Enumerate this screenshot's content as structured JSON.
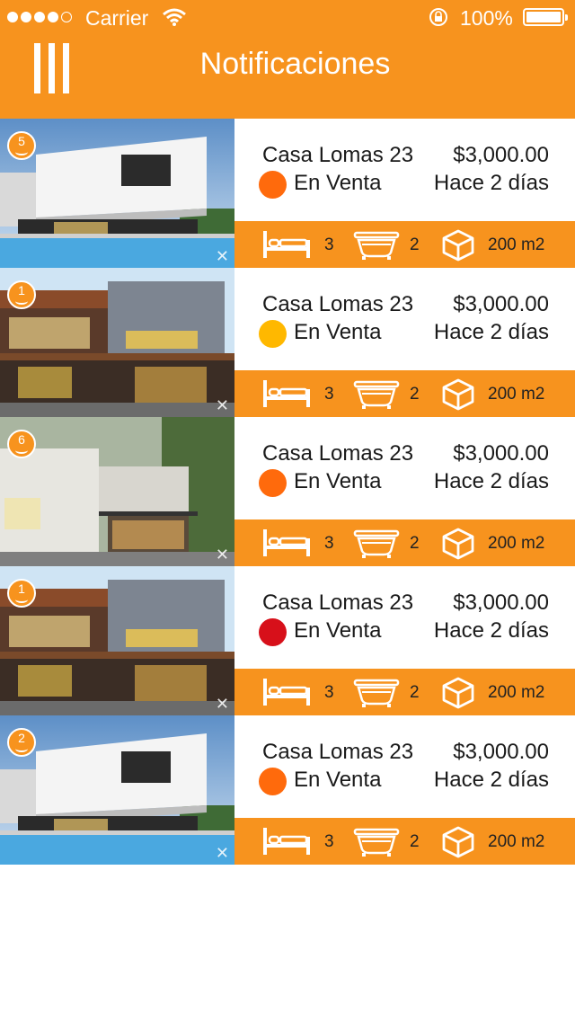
{
  "status_bar": {
    "carrier": "Carrier",
    "battery_pct": "100%"
  },
  "header": {
    "title": "Notificaciones",
    "menu_icon": "menu-icon"
  },
  "colors": {
    "brand": "#F7931E",
    "status_orange": "#FF6A0C",
    "status_yellow": "#FFB800",
    "status_red": "#D7101A"
  },
  "listings": [
    {
      "badge": "5",
      "image": "house-modern-pool",
      "name": "Casa Lomas 23",
      "price": "$3,000.00",
      "status": "En Venta",
      "status_color": "#FF6A0C",
      "time": "Hace 2 días",
      "beds": "3",
      "baths": "2",
      "area": "200 m2"
    },
    {
      "badge": "1",
      "image": "house-wood-brick",
      "name": "Casa Lomas 23",
      "price": "$3,000.00",
      "status": "En Venta",
      "status_color": "#FFB800",
      "time": "Hace 2 días",
      "beds": "3",
      "baths": "2",
      "area": "200 m2"
    },
    {
      "badge": "6",
      "image": "house-stone-garage",
      "name": "Casa Lomas 23",
      "price": "$3,000.00",
      "status": "En Venta",
      "status_color": "#FF6A0C",
      "time": "Hace 2 días",
      "beds": "3",
      "baths": "2",
      "area": "200 m2"
    },
    {
      "badge": "1",
      "image": "house-wood-brick",
      "name": "Casa Lomas 23",
      "price": "$3,000.00",
      "status": "En Venta",
      "status_color": "#D7101A",
      "time": "Hace 2 días",
      "beds": "3",
      "baths": "2",
      "area": "200 m2"
    },
    {
      "badge": "2",
      "image": "house-modern-pool",
      "name": "Casa Lomas 23",
      "price": "$3,000.00",
      "status": "En Venta",
      "status_color": "#FF6A0C",
      "time": "Hace 2 días",
      "beds": "3",
      "baths": "2",
      "area": "200 m2"
    }
  ]
}
